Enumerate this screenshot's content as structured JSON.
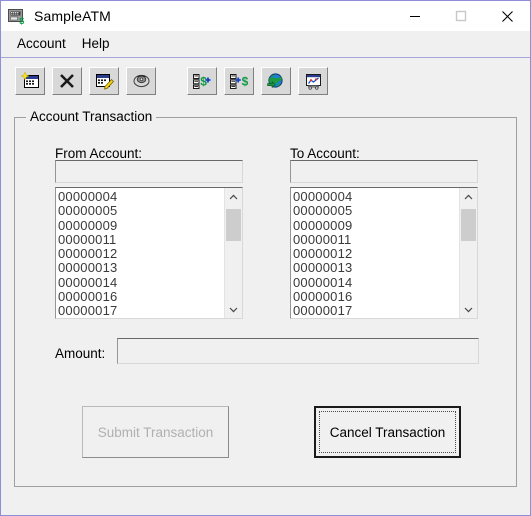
{
  "window": {
    "title": "SampleATM",
    "icon": "atm-machine-icon",
    "border_color": "#8e8ed8",
    "background": "#f0f0f0",
    "controls": [
      {
        "name": "minimize",
        "glyph": "minimize-icon",
        "enabled": true
      },
      {
        "name": "maximize",
        "glyph": "maximize-icon",
        "enabled": false
      },
      {
        "name": "close",
        "glyph": "close-icon",
        "enabled": true
      }
    ]
  },
  "menubar": {
    "items": [
      {
        "label": "Account"
      },
      {
        "label": "Help"
      }
    ]
  },
  "toolbar": {
    "groups": [
      {
        "buttons": [
          {
            "icon": "new-account-icon",
            "tip": "New Account"
          },
          {
            "icon": "delete-account-icon",
            "tip": "Delete Account"
          },
          {
            "icon": "edit-account-icon",
            "tip": "Edit Account"
          },
          {
            "icon": "print-icon",
            "tip": "Print"
          }
        ]
      },
      {
        "buttons": [
          {
            "icon": "deposit-icon",
            "tip": "Deposit"
          },
          {
            "icon": "withdraw-icon",
            "tip": "Withdraw"
          },
          {
            "icon": "transfer-globe-icon",
            "tip": "Transfer"
          },
          {
            "icon": "report-chart-icon",
            "tip": "Report"
          }
        ]
      }
    ]
  },
  "main": {
    "group_title": "Account Transaction",
    "from_account": {
      "label": "From Account:",
      "value": "",
      "items": [
        "00000004",
        "00000005",
        "00000009",
        "00000011",
        "00000012",
        "00000013",
        "00000014",
        "00000016",
        "00000017"
      ]
    },
    "to_account": {
      "label": "To Account:",
      "value": "",
      "items": [
        "00000004",
        "00000005",
        "00000009",
        "00000011",
        "00000012",
        "00000013",
        "00000014",
        "00000016",
        "00000017"
      ]
    },
    "amount": {
      "label": "Amount:",
      "value": "",
      "enabled": false
    },
    "submit_button": {
      "label": "Submit Transaction",
      "enabled": false
    },
    "cancel_button": {
      "label": "Cancel Transaction",
      "enabled": true,
      "focused": true
    }
  }
}
